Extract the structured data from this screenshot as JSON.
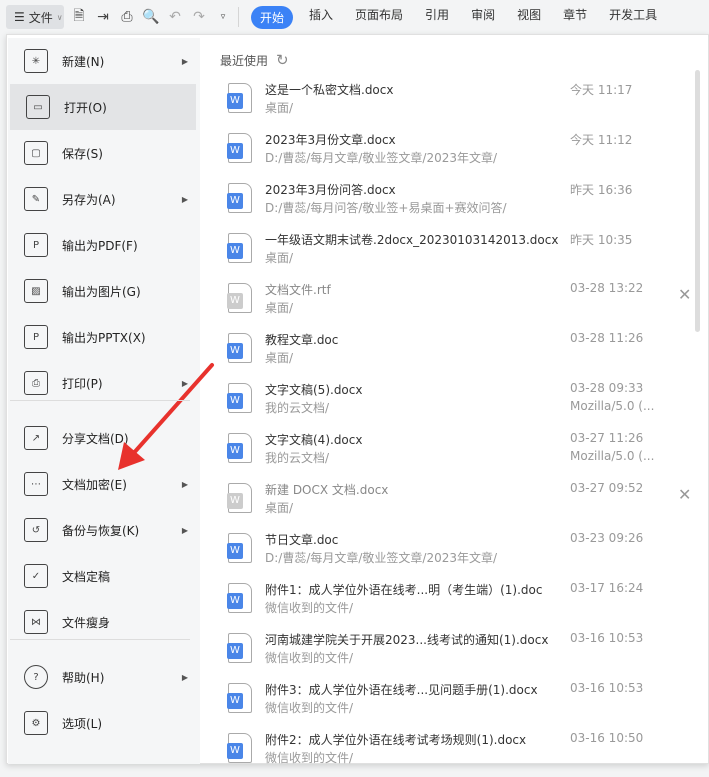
{
  "toolbar": {
    "file_label": "文件",
    "tabs": [
      "开始",
      "插入",
      "页面布局",
      "引用",
      "审阅",
      "视图",
      "章节",
      "开发工具"
    ]
  },
  "menu": [
    {
      "label": "新建(N)",
      "icon": "new-icon",
      "arrow": true
    },
    {
      "label": "打开(O)",
      "icon": "open-folder-icon",
      "arrow": false
    },
    {
      "label": "保存(S)",
      "icon": "save-icon",
      "arrow": false
    },
    {
      "label": "另存为(A)",
      "icon": "save-as-icon",
      "arrow": true
    },
    {
      "label": "输出为PDF(F)",
      "icon": "pdf-icon",
      "arrow": false
    },
    {
      "label": "输出为图片(G)",
      "icon": "image-icon",
      "arrow": false
    },
    {
      "label": "输出为PPTX(X)",
      "icon": "pptx-icon",
      "arrow": false
    },
    {
      "label": "打印(P)",
      "icon": "print-icon",
      "arrow": true
    },
    {
      "label": "分享文档(D)",
      "icon": "share-icon",
      "arrow": false
    },
    {
      "label": "文档加密(E)",
      "icon": "encrypt-icon",
      "arrow": true
    },
    {
      "label": "备份与恢复(K)",
      "icon": "backup-icon",
      "arrow": true
    },
    {
      "label": "文档定稿",
      "icon": "finalize-icon",
      "arrow": false
    },
    {
      "label": "文件瘦身",
      "icon": "slim-icon",
      "arrow": false
    },
    {
      "label": "帮助(H)",
      "icon": "help-icon",
      "arrow": true
    },
    {
      "label": "选项(L)",
      "icon": "gear-icon",
      "arrow": false
    }
  ],
  "recent": {
    "title": "最近使用",
    "files": [
      {
        "name": "这是一个私密文档.docx",
        "path": "桌面/",
        "time": "今天  11:17"
      },
      {
        "name": "2023年3月份文章.docx",
        "path": "D:/曹蕊/每月文章/敬业签文章/2023年文章/",
        "time": "今天  11:12"
      },
      {
        "name": "2023年3月份问答.docx",
        "path": "D:/曹蕊/每月问答/敬业签+易桌面+赛效问答/",
        "time": "昨天  16:36"
      },
      {
        "name": "一年级语文期末试卷.2docx_20230103142013.docx",
        "path": "桌面/",
        "time": "昨天  10:35"
      },
      {
        "name": "文档文件.rtf",
        "path": "桌面/",
        "time": "03-28 13:22",
        "dim": true
      },
      {
        "name": "教程文章.doc",
        "path": "桌面/",
        "time": "03-28 11:26"
      },
      {
        "name": "文字文稿(5).docx",
        "path": "我的云文档/",
        "time": "03-28 09:33",
        "src": "Mozilla/5.0 (..."
      },
      {
        "name": "文字文稿(4).docx",
        "path": "我的云文档/",
        "time": "03-27 11:26",
        "src": "Mozilla/5.0 (..."
      },
      {
        "name": "新建 DOCX 文档.docx",
        "path": "桌面/",
        "time": "03-27 09:52",
        "dim": true
      },
      {
        "name": "节日文章.doc",
        "path": "D:/曹蕊/每月文章/敬业签文章/2023年文章/",
        "time": "03-23 09:26"
      },
      {
        "name": "附件1：成人学位外语在线考...明（考生端）(1).doc",
        "path": "微信收到的文件/",
        "time": "03-17 16:24"
      },
      {
        "name": "河南城建学院关于开展2023...线考试的通知(1).docx",
        "path": "微信收到的文件/",
        "time": "03-16 10:53"
      },
      {
        "name": "附件3：成人学位外语在线考...见问题手册(1).docx",
        "path": "微信收到的文件/",
        "time": "03-16 10:53"
      },
      {
        "name": "附件2：成人学位外语在线考试考场规则(1).docx",
        "path": "微信收到的文件/",
        "time": "03-16 10:50"
      }
    ]
  }
}
